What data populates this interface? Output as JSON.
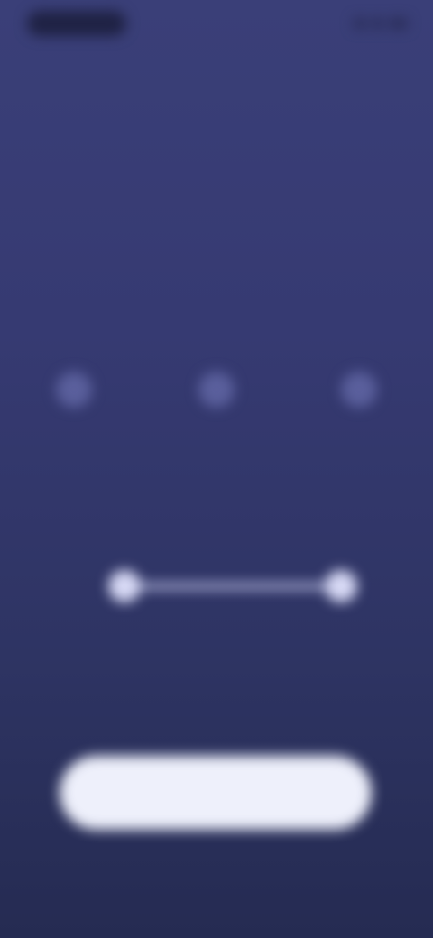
{
  "status_bar": {
    "time": "",
    "icons": [
      "signal-icon",
      "wifi-icon",
      "battery-icon"
    ]
  },
  "header": {
    "title": "",
    "subtitle": ""
  },
  "options": [
    {
      "icon": "option-icon",
      "label": ""
    },
    {
      "icon": "option-icon",
      "label": ""
    },
    {
      "icon": "option-icon",
      "label": ""
    }
  ],
  "range": {
    "min_label": "",
    "max_label": "",
    "low_fraction": 0.0,
    "high_fraction": 1.0
  },
  "actions": {
    "primary_label": "",
    "secondary_label": ""
  },
  "colors": {
    "background_top": "#3a3f78",
    "background_bottom": "#252b52",
    "button": "#eef0fb"
  }
}
